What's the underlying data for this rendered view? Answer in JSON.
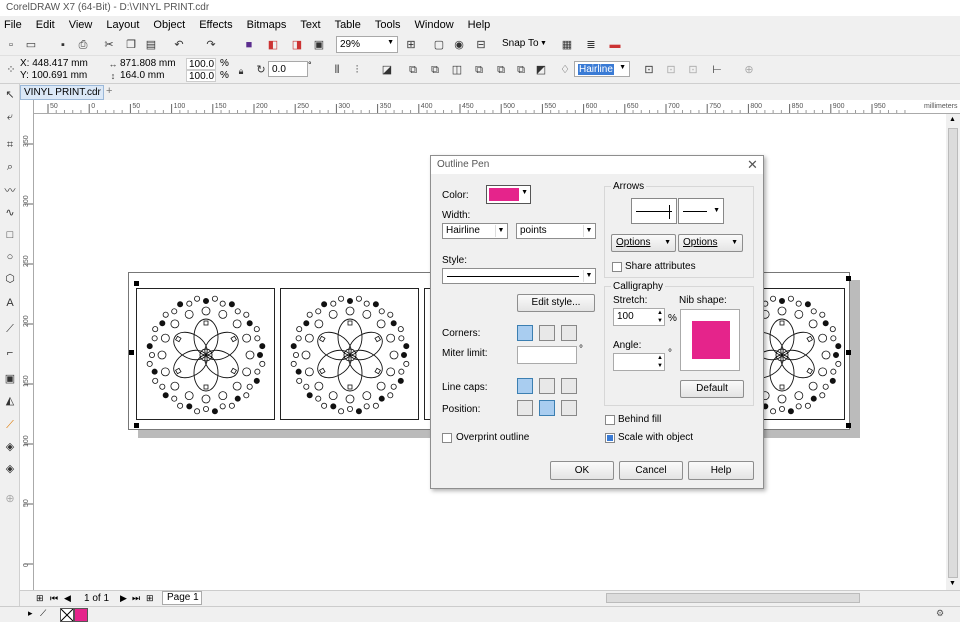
{
  "app": {
    "title": "CorelDRAW X7 (64-Bit) - D:\\VINYL PRINT.cdr"
  },
  "menu": [
    "File",
    "Edit",
    "View",
    "Layout",
    "Object",
    "Effects",
    "Bitmaps",
    "Text",
    "Table",
    "Tools",
    "Window",
    "Help"
  ],
  "toolbar": {
    "zoom": "29%",
    "snap_to": "Snap To"
  },
  "propbar": {
    "x": "X: 448.417 mm",
    "y": "Y: 100.691 mm",
    "w": "871.808 mm",
    "h": "164.0 mm",
    "sx": "100.0",
    "sy": "100.0",
    "pct": "%",
    "angle": "0.0",
    "deg": "°",
    "outline": "Hairline"
  },
  "doc_tab": "VINYL PRINT.cdr",
  "ruler": {
    "h_ticks": [
      "50",
      "0",
      "50",
      "100",
      "150",
      "200",
      "250",
      "300",
      "350",
      "400",
      "450",
      "500",
      "550",
      "600",
      "650",
      "700",
      "750",
      "800",
      "850",
      "900",
      "950"
    ],
    "unit": "millimeters",
    "v_ticks": [
      "350",
      "300",
      "250",
      "200",
      "150",
      "100",
      "50",
      "0"
    ]
  },
  "dialog": {
    "title": "Outline Pen",
    "color_label": "Color:",
    "color": "#e5248b",
    "width_label": "Width:",
    "width_value": "Hairline",
    "width_unit": "points",
    "style_label": "Style:",
    "edit_style": "Edit style...",
    "corners_label": "Corners:",
    "miter_label": "Miter limit:",
    "miter_unit": "°",
    "linecaps_label": "Line caps:",
    "position_label": "Position:",
    "overprint": "Overprint outline",
    "arrows_label": "Arrows",
    "options1": "Options",
    "options2": "Options",
    "share_attr": "Share attributes",
    "calligraphy_label": "Calligraphy",
    "stretch_label": "Stretch:",
    "stretch_value": "100",
    "stretch_unit": "%",
    "nib_label": "Nib shape:",
    "angle_label": "Angle:",
    "angle_unit": "°",
    "default_btn": "Default",
    "behind_fill": "Behind fill",
    "scale_with_object": "Scale with object",
    "ok": "OK",
    "cancel": "Cancel",
    "help": "Help"
  },
  "status": {
    "page_count": "1 of 1",
    "page_tab": "Page 1"
  }
}
